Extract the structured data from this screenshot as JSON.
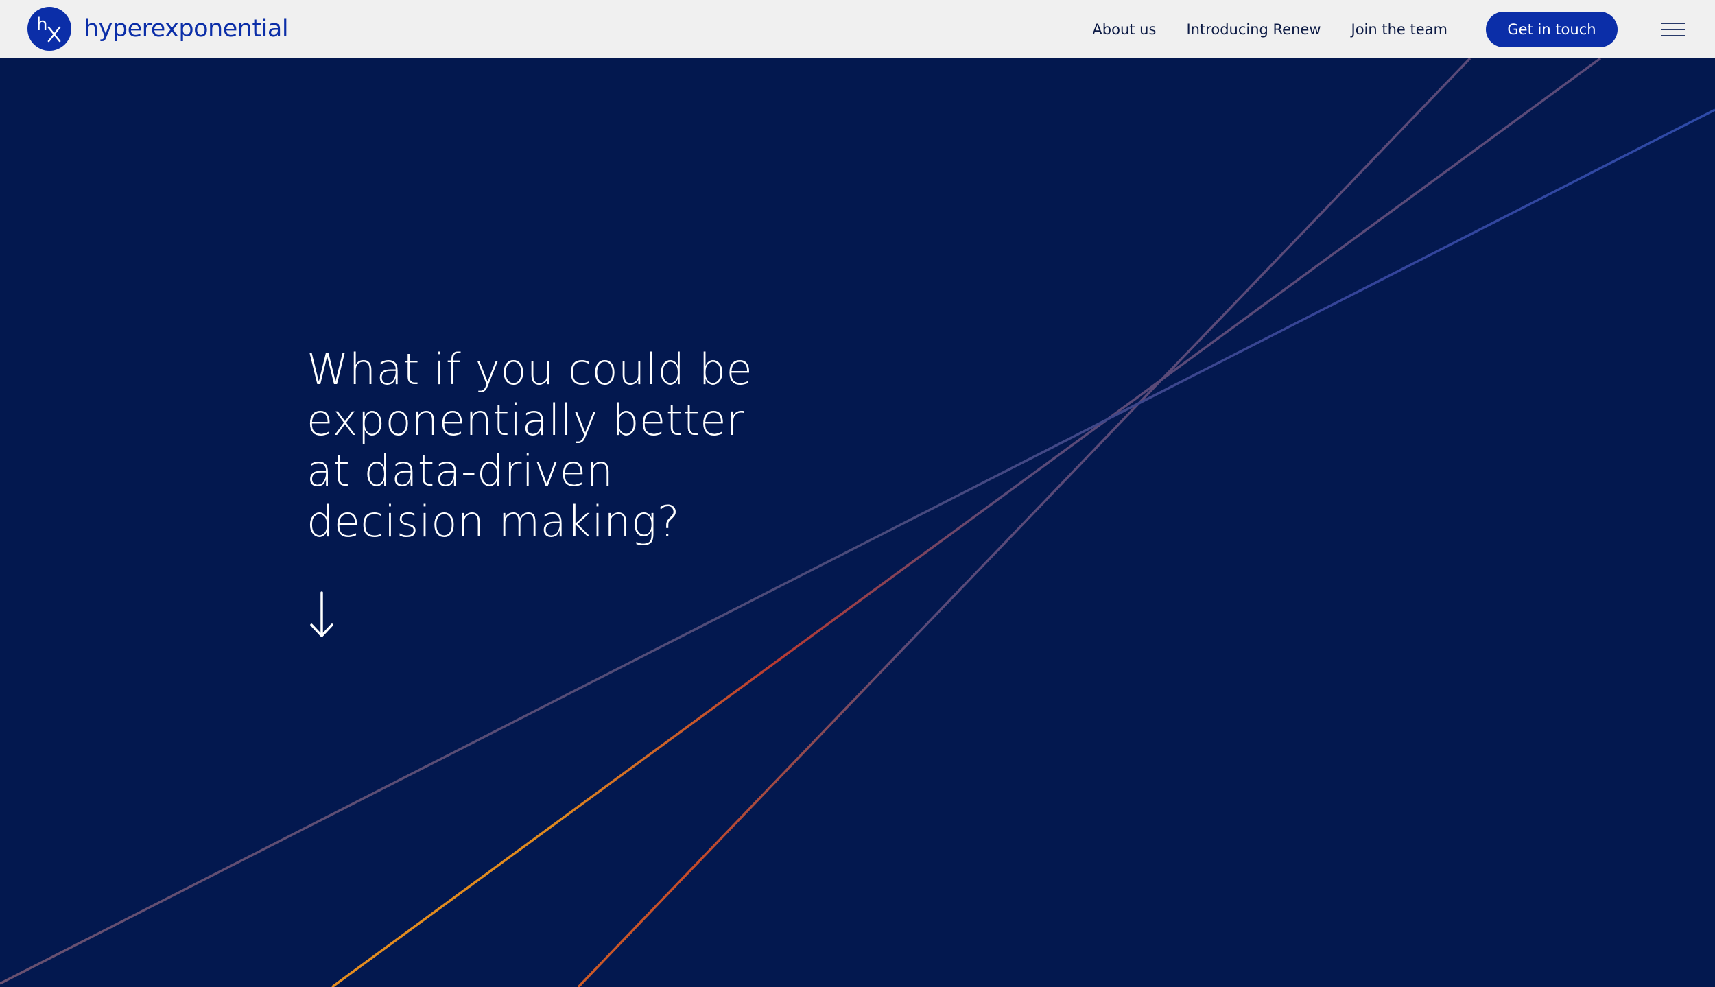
{
  "brand": {
    "logo_text": "hx",
    "name": "hyperexponential",
    "icon": "hx-logo-icon"
  },
  "nav": {
    "links": [
      "About us",
      "Introducing Renew",
      "Join the team"
    ],
    "cta_label": "Get in touch",
    "menu_icon": "hamburger-menu-icon"
  },
  "hero": {
    "headline_lines": [
      "What if you could be",
      "exponentially better",
      "at data-driven",
      "decision making?"
    ],
    "scroll_icon": "arrow-down-icon"
  },
  "colors": {
    "background": "#03184f",
    "header_background": "#f0f0f0",
    "brand_blue": "#0b2ea8",
    "line_orange": "#e08a1e",
    "line_red": "#b83a32",
    "line_blue": "#2e4aa8",
    "line_muted": "#5a4a78"
  }
}
